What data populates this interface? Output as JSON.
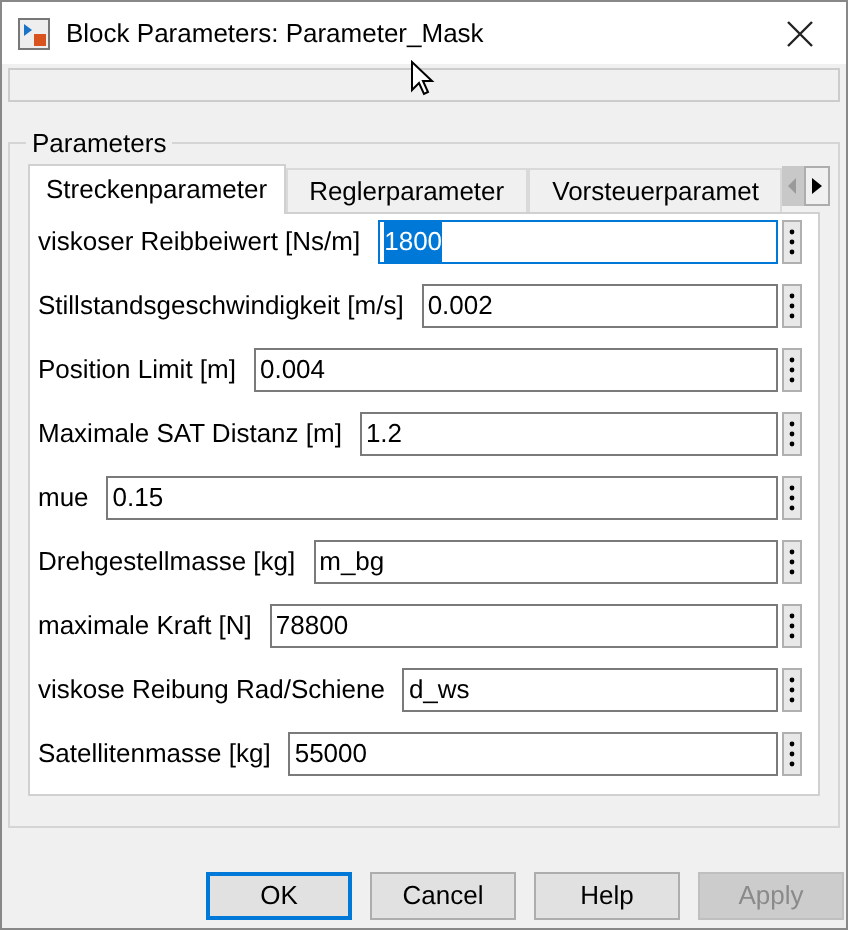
{
  "window": {
    "title": "Block Parameters: Parameter_Mask"
  },
  "group": {
    "title": "Parameters"
  },
  "tabs": [
    {
      "label": "Streckenparameter",
      "selected": true
    },
    {
      "label": "Reglerparameter",
      "selected": false
    },
    {
      "label": "Vorsteuerparamet",
      "selected": false
    }
  ],
  "tab_scroll": {
    "left_disabled": true,
    "right_disabled": false
  },
  "fields": [
    {
      "label": "viskoser Reibbeiwert [Ns/m]",
      "value": "1800",
      "focused": true
    },
    {
      "label": "Stillstandsgeschwindigkeit [m/s]",
      "value": "0.002",
      "focused": false
    },
    {
      "label": "Position Limit [m]",
      "value": "0.004",
      "focused": false
    },
    {
      "label": "Maximale SAT Distanz [m]",
      "value": "1.2",
      "focused": false
    },
    {
      "label": "mue",
      "value": "0.15",
      "focused": false
    },
    {
      "label": "Drehgestellmasse [kg]",
      "value": "m_bg",
      "focused": false
    },
    {
      "label": "maximale Kraft [N]",
      "value": "78800",
      "focused": false
    },
    {
      "label": "viskose Reibung Rad/Schiene",
      "value": "d_ws",
      "focused": false
    },
    {
      "label": "Satellitenmasse [kg]",
      "value": "55000",
      "focused": false
    }
  ],
  "buttons": [
    {
      "label": "OK",
      "default": true,
      "disabled": false
    },
    {
      "label": "Cancel",
      "default": false,
      "disabled": false
    },
    {
      "label": "Help",
      "default": false,
      "disabled": false
    },
    {
      "label": "Apply",
      "default": false,
      "disabled": true
    }
  ]
}
